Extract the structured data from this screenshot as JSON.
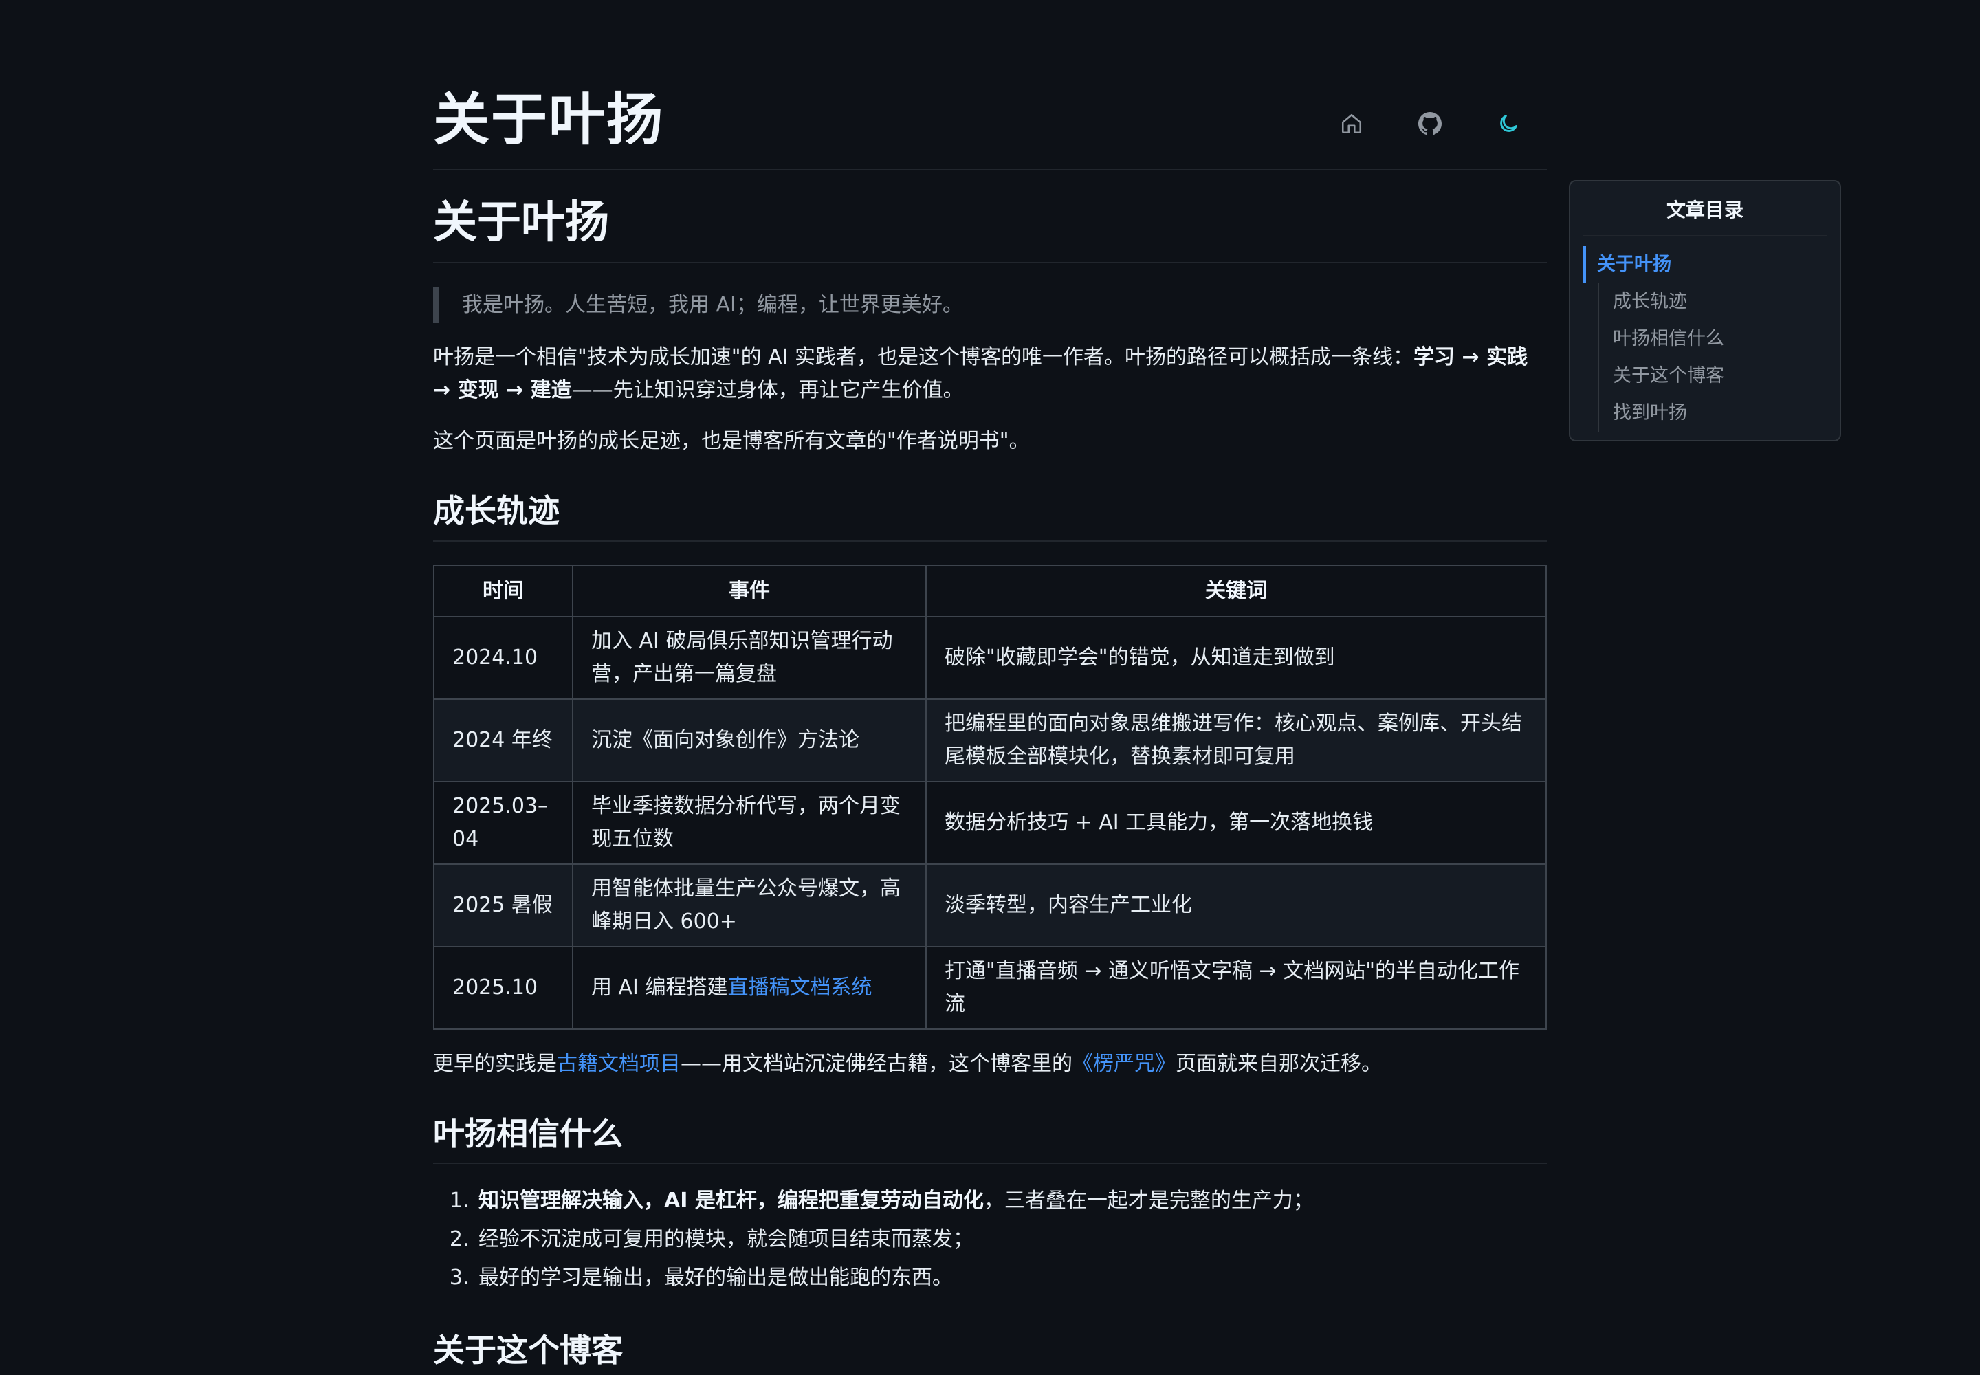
{
  "header": {
    "site_title": "关于叶扬",
    "icons": [
      "home-icon",
      "github-icon",
      "moon-icon"
    ]
  },
  "article": {
    "title": "关于叶扬",
    "quote": "我是叶扬。人生苦短，我用 AI；编程，让世界更美好。",
    "intro": {
      "part1": "叶扬是一个相信\"技术为成长加速\"的 AI 实践者，也是这个博客的唯一作者。叶扬的路径可以概括成一条线：",
      "path_bold": "学习 → 实践 → 变现 → 建造",
      "part2": "——先让知识穿过身体，再让它产生价值。"
    },
    "intro2": "这个页面是叶扬的成长足迹，也是博客所有文章的\"作者说明书\"。",
    "growth": {
      "heading": "成长轨迹",
      "columns": [
        "时间",
        "事件",
        "关键词"
      ],
      "rows": [
        {
          "time": "2024.10",
          "event": "加入 AI 破局俱乐部知识管理行动营，产出第一篇复盘",
          "keyword": "破除\"收藏即学会\"的错觉，从知道走到做到"
        },
        {
          "time": "2024 年终",
          "event": "沉淀《面向对象创作》方法论",
          "keyword": "把编程里的面向对象思维搬进写作：核心观点、案例库、开头结尾模板全部模块化，替换素材即可复用"
        },
        {
          "time": "2025.03–04",
          "event": "毕业季接数据分析代写，两个月变现五位数",
          "keyword": "数据分析技巧 + AI 工具能力，第一次落地换钱"
        },
        {
          "time": "2025 暑假",
          "event": "用智能体批量生产公众号爆文，高峰期日入 600+",
          "keyword": "淡季转型，内容生产工业化"
        },
        {
          "time": "2025.10",
          "event_prefix": "用 AI 编程搭建",
          "event_link": "直播稿文档系统",
          "keyword": "打通\"直播音频 → 通义听悟文字稿 → 文档网站\"的半自动化工作流"
        }
      ],
      "after": {
        "prefix": "更早的实践是",
        "link1": "古籍文档项目",
        "middle": "——用文档站沉淀佛经古籍，这个博客里的",
        "link2": "《楞严咒》",
        "suffix": "页面就来自那次迁移。"
      }
    },
    "beliefs": {
      "heading": "叶扬相信什么",
      "items": [
        {
          "bold": "知识管理解决输入，AI 是杠杆，编程把重复劳动自动化",
          "rest": "，三者叠在一起才是完整的生产力；"
        },
        {
          "bold": "",
          "rest": "经验不沉淀成可复用的模块，就会随项目结束而蒸发；"
        },
        {
          "bold": "",
          "rest": "最好的学习是输出，最好的输出是做出能跑的东西。"
        }
      ]
    },
    "about_blog_heading": "关于这个博客"
  },
  "toc": {
    "title": "文章目录",
    "items": [
      {
        "label": "关于叶扬",
        "active": true
      },
      {
        "label": "成长轨迹"
      },
      {
        "label": "叶扬相信什么"
      },
      {
        "label": "关于这个博客"
      },
      {
        "label": "找到叶扬"
      }
    ]
  },
  "colors": {
    "background": "#0d1117",
    "link": "#4493f8",
    "moon_icon": "#2fc8d8",
    "muted": "#9198a1"
  }
}
